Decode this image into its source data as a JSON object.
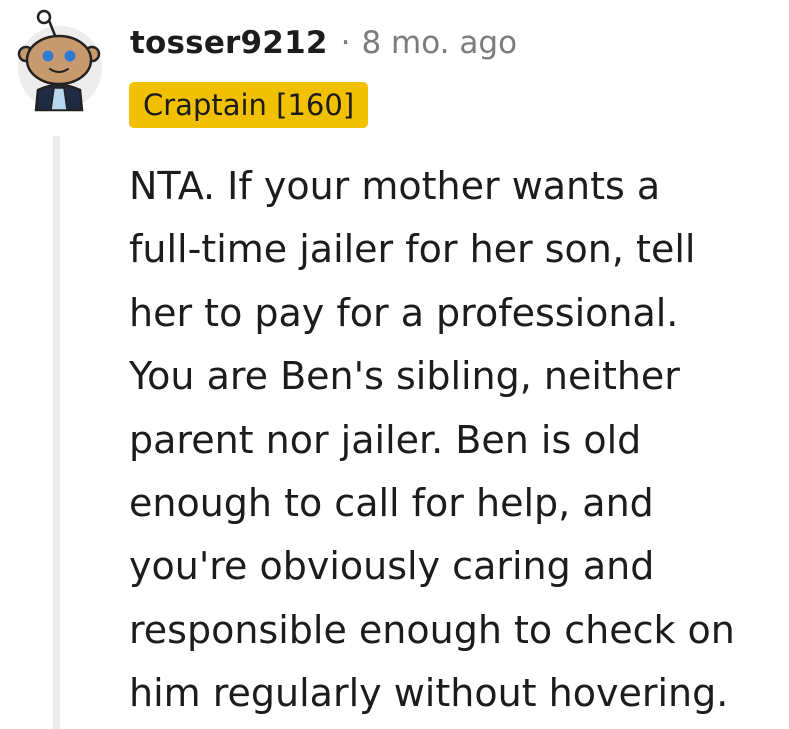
{
  "comment": {
    "username": "tosser9212",
    "separator": "·",
    "timestamp": "8 mo. ago",
    "flair": "Craptain [160]",
    "body_lines": [
      "NTA. If your mother wants a",
      "full-time jailer for her son, tell",
      "her to pay for a professional.",
      "You are Ben's sibling, neither",
      "parent nor jailer. Ben is old",
      "enough to call for help, and",
      "you're obviously caring and",
      "responsible enough to check on",
      "him regularly without hovering."
    ]
  },
  "colors": {
    "flair_background": "#f1c100",
    "text": "#1c1c1c",
    "muted_text": "#7c7c7c",
    "thread_line": "#ececec",
    "avatar_background": "#ededed"
  },
  "icons": {
    "avatar": "snoo-avatar-icon"
  }
}
